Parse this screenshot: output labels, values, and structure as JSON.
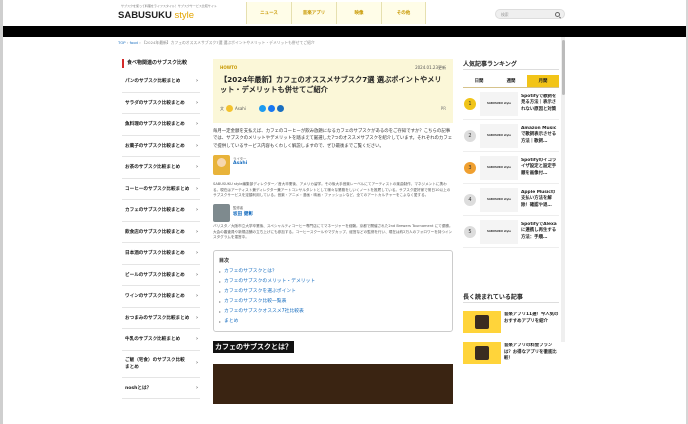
{
  "header": {
    "tagline": "サブスクを使って料理をライフスタイル！サブスクサービス比較サイト",
    "logo_main": "SABUSUKU",
    "logo_accent": "style",
    "nav": [
      {
        "label": "ニュース"
      },
      {
        "label": "音楽アプリ"
      },
      {
        "label": "映像"
      },
      {
        "label": "その他"
      }
    ],
    "search_placeholder": "検索"
  },
  "breadcrumb": {
    "home": "TOP",
    "sep": "›",
    "cat": "food",
    "current": "【2024年最新】カフェのオススメサブスク7選 選ぶポイントやメリット・デメリットも併せてご紹介"
  },
  "left_sidebar": {
    "title": "食べ物関連のサブスク比較",
    "items": [
      {
        "label": "パンのサブスク比較まとめ"
      },
      {
        "label": "サラダのサブスク比較まとめ"
      },
      {
        "label": "魚料理のサブスク比較まとめ"
      },
      {
        "label": "お菓子のサブスク比較まとめ"
      },
      {
        "label": "お茶のサブスク比較まとめ"
      },
      {
        "label": "コーヒーのサブスク比較まとめ"
      },
      {
        "label": "カフェのサブスク比較まとめ"
      },
      {
        "label": "飲食店のサブスク比較まとめ"
      },
      {
        "label": "日本酒のサブスク比較まとめ"
      },
      {
        "label": "ビールのサブスク比較まとめ"
      },
      {
        "label": "ワインのサブスク比較まとめ"
      },
      {
        "label": "おつまみのサブスク比較まとめ"
      },
      {
        "label": "牛乳のサブスク比較まとめ"
      },
      {
        "label": "ご飯（宅食）のサブスク比較まとめ"
      },
      {
        "label": "noshとは？"
      }
    ]
  },
  "article": {
    "category": "HOWTO",
    "date": "2024.01.23更新",
    "title": "【2024年最新】カフェのオススメサブスク7選 選ぶポイントやメリット・デメリットも併せてご紹介",
    "author_label": "文",
    "author_name": "Asahi",
    "pr": "PR",
    "lead": "毎月一定金額を支払えば、カフェのコーヒーが飲み放題になるカフェのサブスクがあるのをご存知ですか？こちらの記事では、サブスクのメリットやデメリットを踏まえて厳選した7つのオススメサブスクを紹介しています。それぞれのカフェで提供しているサービス内容もくわしく解説しますので、ぜひ最後までご覧ください。",
    "writer_role": "ライター",
    "writer_name": "Asahi",
    "writer_bio": "SABUSUKU style編集部ディレクター／音大卒業後、アメリカ留学。その後大手音楽レーベルにてアーティストの楽曲制作、マネジメントに携わる。現在はアーティスト兼ディレクター兼アートコンサルタントとして様々な業務をしいくノートを推薦している。サブスク愛好家で常日10以上のサブスクサービスを定額利用している。音楽・アニメ・漫画・映画・ファッションなど、全てのアートカルチャーをこよなく愛する。",
    "sup_role": "監修者",
    "sup_name": "坂田 健彰",
    "sup_bio": "バリスタ／大阪市立大学卒業後、スペシャルティコーヒー専門店にてマネージャーを経験。京都で開催された2nd Brewers Tournament にて優勝。大会の審査員や新規店舗の立ち上げにも参加する。コーヒースクールやマグカップ、経営などの監修を行い、現在は約2万人のフォロワーを持つインスタグラムを運営中。",
    "toc_title": "目次",
    "toc": [
      {
        "label": "カフェのサブスクとは？"
      },
      {
        "label": "カフェのサブスクのメリット・デメリット"
      },
      {
        "label": "カフェのサブスクを選ぶポイント"
      },
      {
        "label": "カフェのサブスク比較一覧表"
      },
      {
        "label": "カフェのサブスクオススメ7社比較表"
      },
      {
        "label": "まとめ"
      }
    ],
    "h2": "カフェのサブスクとは？"
  },
  "right_sidebar": {
    "ranking_title": "人気記事ランキング",
    "tabs": [
      {
        "label": "日間",
        "active": false
      },
      {
        "label": "週間",
        "active": false
      },
      {
        "label": "月間",
        "active": true
      }
    ],
    "ranking": [
      {
        "num": "1",
        "thumb": "SABUSUKU style",
        "title": "Spotifyで歌詞を見る方法｜表示されない原因と対策"
      },
      {
        "num": "2",
        "thumb": "SABUSUKU style",
        "title": "Amazon Musicで歌詞表示させる方法｜歌詞…"
      },
      {
        "num": "3",
        "thumb": "SABUSUKU style",
        "title": "Spotifyのイコライザ設定と設定手順を画像付…"
      },
      {
        "num": "4",
        "thumb": "SABUSUKU style",
        "title": "Apple Musicの支払い方法を解除！確認や退…"
      },
      {
        "num": "5",
        "thumb": "SABUSUKU style",
        "title": "SpotifyでAlexaに連携し再生する方法：手順…"
      }
    ],
    "read_title": "長く読まれている記事",
    "read": [
      {
        "title": "音楽アプリ11選！今人気のおすすめアプリを紹介"
      },
      {
        "title": "音楽アプリの料金プランは？お得なアプリを徹底比較！"
      }
    ]
  },
  "colors": {
    "accent": "#e3a400",
    "tab_active": "#f2c418",
    "link": "#1a6fc0",
    "sidebar_marker": "#d42a2a"
  }
}
